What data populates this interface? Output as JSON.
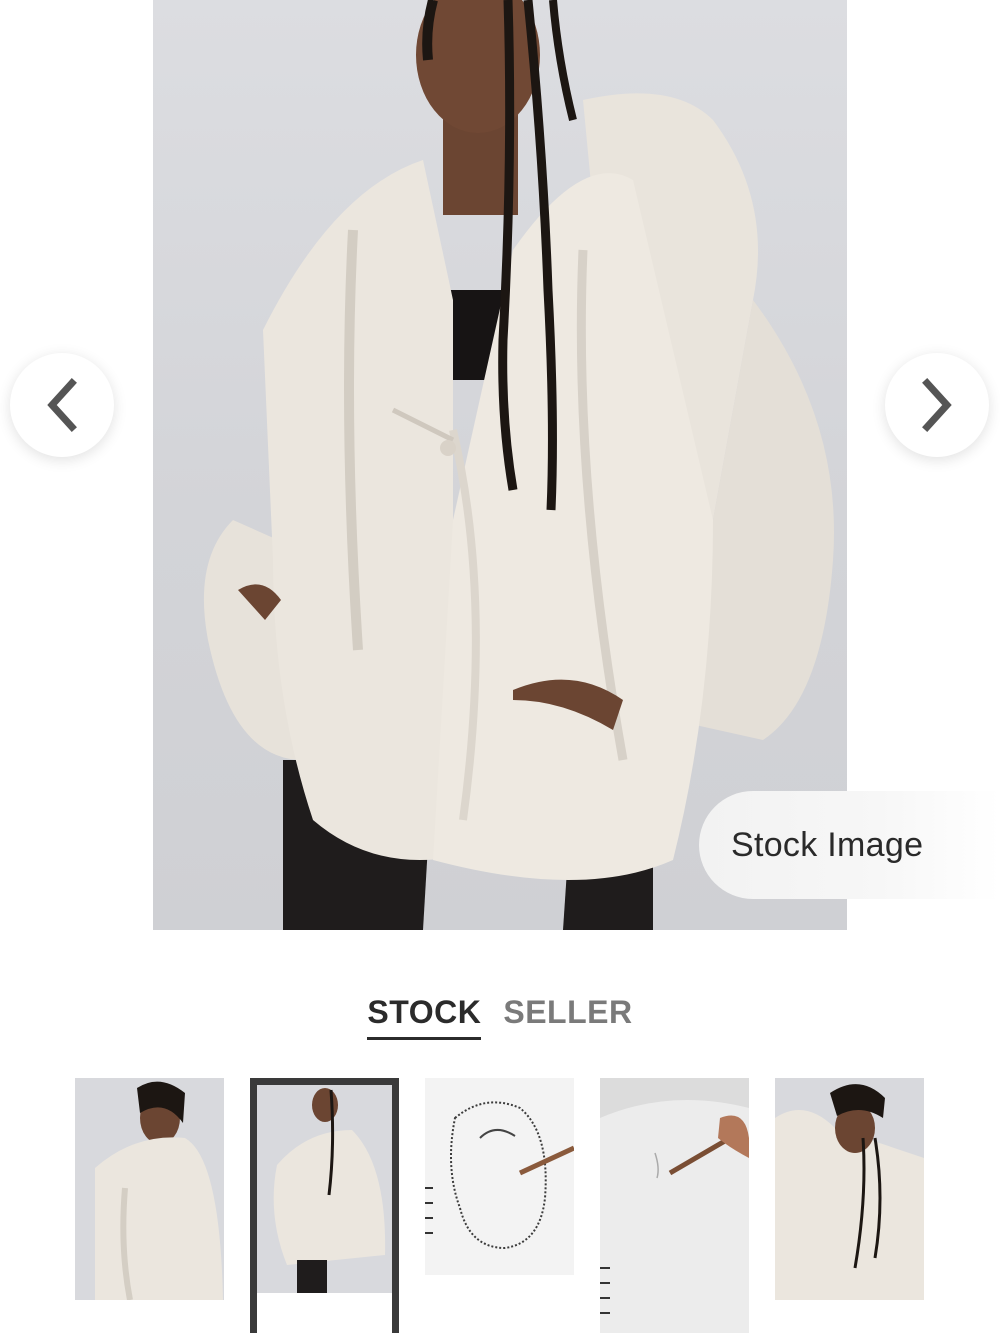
{
  "gallery": {
    "badge_text": "Stock Image",
    "prev_icon": "chevron-left-icon",
    "next_icon": "chevron-right-icon"
  },
  "source_tabs": {
    "stock_label": "STOCK",
    "seller_label": "SELLER",
    "active": "STOCK"
  },
  "thumbnails": [
    {
      "id": "thumb-1",
      "selected": false
    },
    {
      "id": "thumb-2",
      "selected": true
    },
    {
      "id": "thumb-3",
      "selected": false
    },
    {
      "id": "thumb-4",
      "selected": false
    },
    {
      "id": "thumb-5",
      "selected": false
    }
  ],
  "colors": {
    "fleece": "#e9e4dc",
    "backdrop": "#d6d7db",
    "skin": "#6b4532",
    "hair": "#1c1612",
    "text_dark": "#2b2b2b",
    "text_muted": "#7a7a7a"
  }
}
